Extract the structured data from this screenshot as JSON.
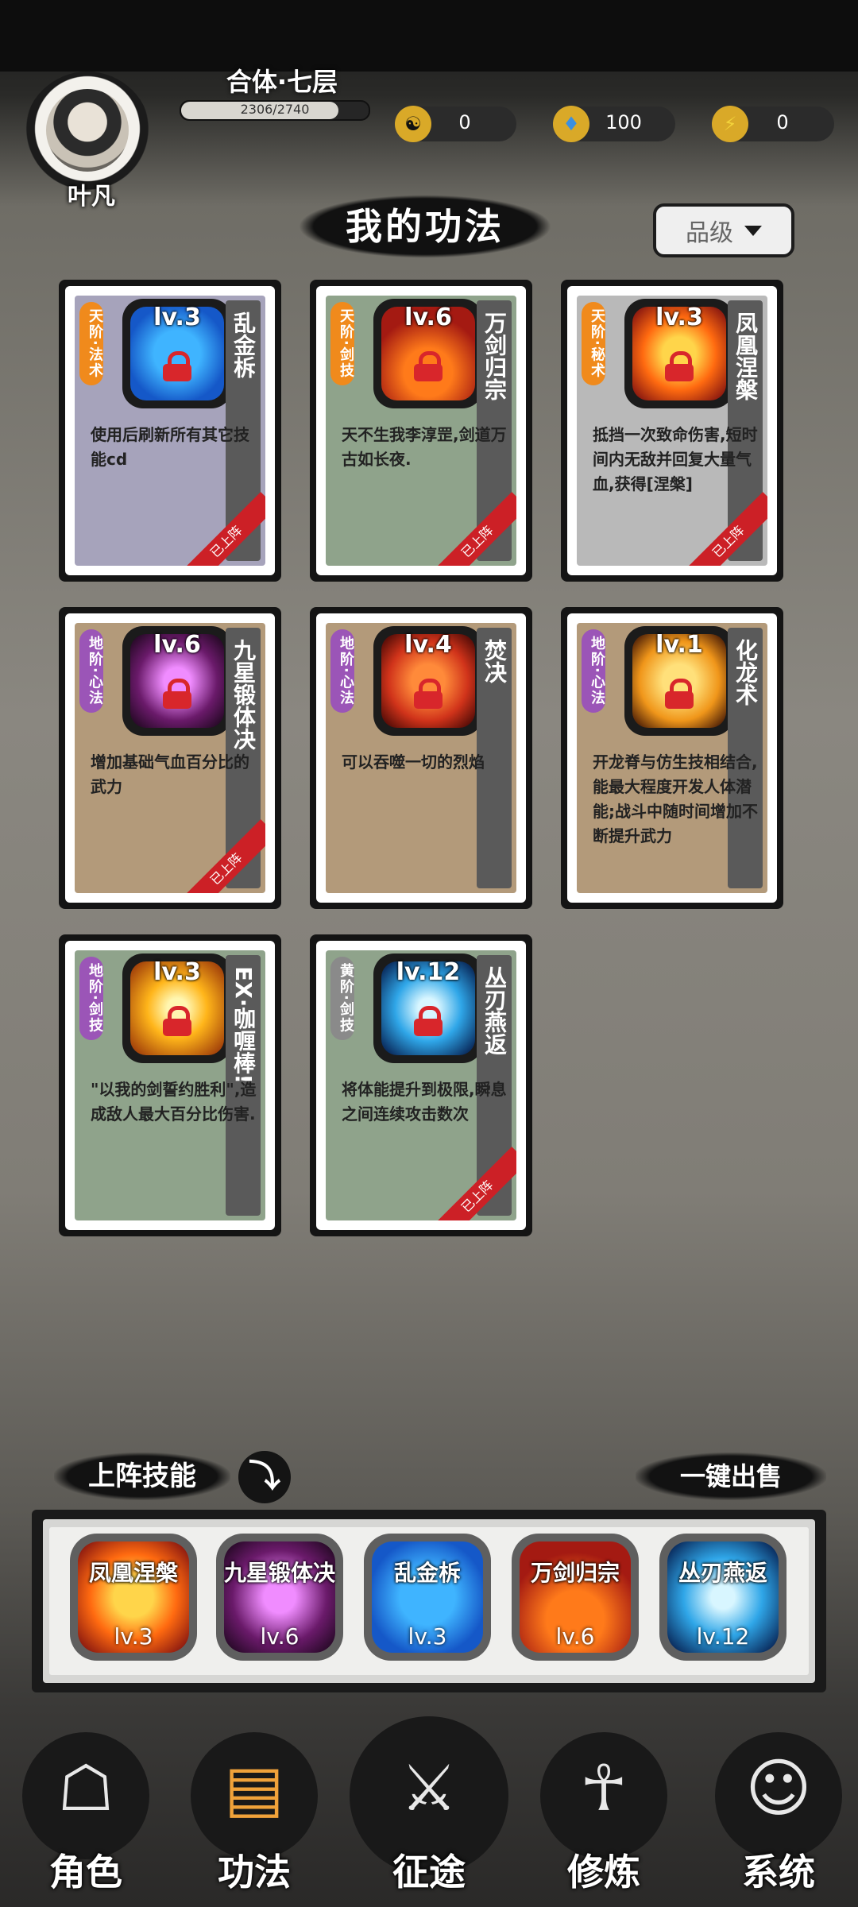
{
  "header": {
    "player_name": "叶凡",
    "realm": "合体·七层",
    "exp_text": "2306/2740",
    "exp_progress": 0.84,
    "resources": [
      {
        "icon": "yin-yang-icon",
        "value": "0"
      },
      {
        "icon": "spirit-crystal-icon",
        "value": "100"
      },
      {
        "icon": "lightning-energy-icon",
        "value": "0"
      }
    ]
  },
  "page": {
    "title": "我的功法",
    "sort_label": "品级"
  },
  "skills": [
    {
      "grade": "天阶·法术",
      "name": "乱金柝",
      "level": "lv.3",
      "desc": "使用后刷新所有其它技能cd",
      "deployed": "已上阵",
      "bg": "#a6a3bb",
      "grade_color": "#f08a1c"
    },
    {
      "grade": "天阶·剑技",
      "name": "万剑归宗",
      "level": "lv.6",
      "desc": "天不生我李淳罡,剑道万古如长夜.",
      "deployed": "已上阵",
      "bg": "#8fa38b",
      "grade_color": "#f08a1c"
    },
    {
      "grade": "天阶·秘术",
      "name": "凤凰涅槃",
      "level": "lv.3",
      "desc": "抵挡一次致命伤害,短时间内无敌并回复大量气血,获得[涅槃]",
      "deployed": "已上阵",
      "bg": "#b9b9b9",
      "grade_color": "#f08a1c"
    },
    {
      "grade": "地阶·心法",
      "name": "九星锻体决",
      "level": "lv.6",
      "desc": "增加基础气血百分比的武力",
      "deployed": "已上阵",
      "bg": "#b39a7a",
      "grade_color": "#9b55b7"
    },
    {
      "grade": "地阶·心法",
      "name": "焚决",
      "level": "lv.4",
      "desc": "可以吞噬一切的烈焰",
      "deployed": "",
      "bg": "#b39a7a",
      "grade_color": "#9b55b7"
    },
    {
      "grade": "地阶·心法",
      "name": "化龙术",
      "level": "lv.1",
      "desc": "开龙脊与仿生技相结合,能最大程度开发人体潜能;战斗中随时间增加不断提升武力",
      "deployed": "",
      "bg": "#b39a7a",
      "grade_color": "#9b55b7"
    },
    {
      "grade": "地阶·剑技",
      "name": "EX·咖喱棒!",
      "level": "lv.3",
      "desc": "\"以我的剑誓约胜利\",造成敌人最大百分比伤害.",
      "deployed": "",
      "bg": "#8fa38b",
      "grade_color": "#9b55b7"
    },
    {
      "grade": "黄阶·剑技",
      "name": "丛刃燕返",
      "level": "lv.12",
      "desc": "将体能提升到极限,瞬息之间连续攻击数次",
      "deployed": "已上阵",
      "bg": "#8fa38b",
      "grade_color": "#8a8a8a"
    }
  ],
  "deployed_section": {
    "title": "上阵技能",
    "sell_all": "一键出售",
    "slots": [
      {
        "name": "凤凰涅槃",
        "level": "lv.3"
      },
      {
        "name": "九星锻体决",
        "level": "lv.6"
      },
      {
        "name": "乱金柝",
        "level": "lv.3"
      },
      {
        "name": "万剑归宗",
        "level": "lv.6"
      },
      {
        "name": "丛刃燕返",
        "level": "lv.12"
      }
    ]
  },
  "nav": [
    {
      "label": "角色",
      "icon": "hooded-character-icon"
    },
    {
      "label": "功法",
      "icon": "scroll-book-icon"
    },
    {
      "label": "征途",
      "icon": "sword-emblem-icon"
    },
    {
      "label": "修炼",
      "icon": "meditating-figure-icon"
    },
    {
      "label": "系统",
      "icon": "chibi-girl-icon"
    }
  ]
}
